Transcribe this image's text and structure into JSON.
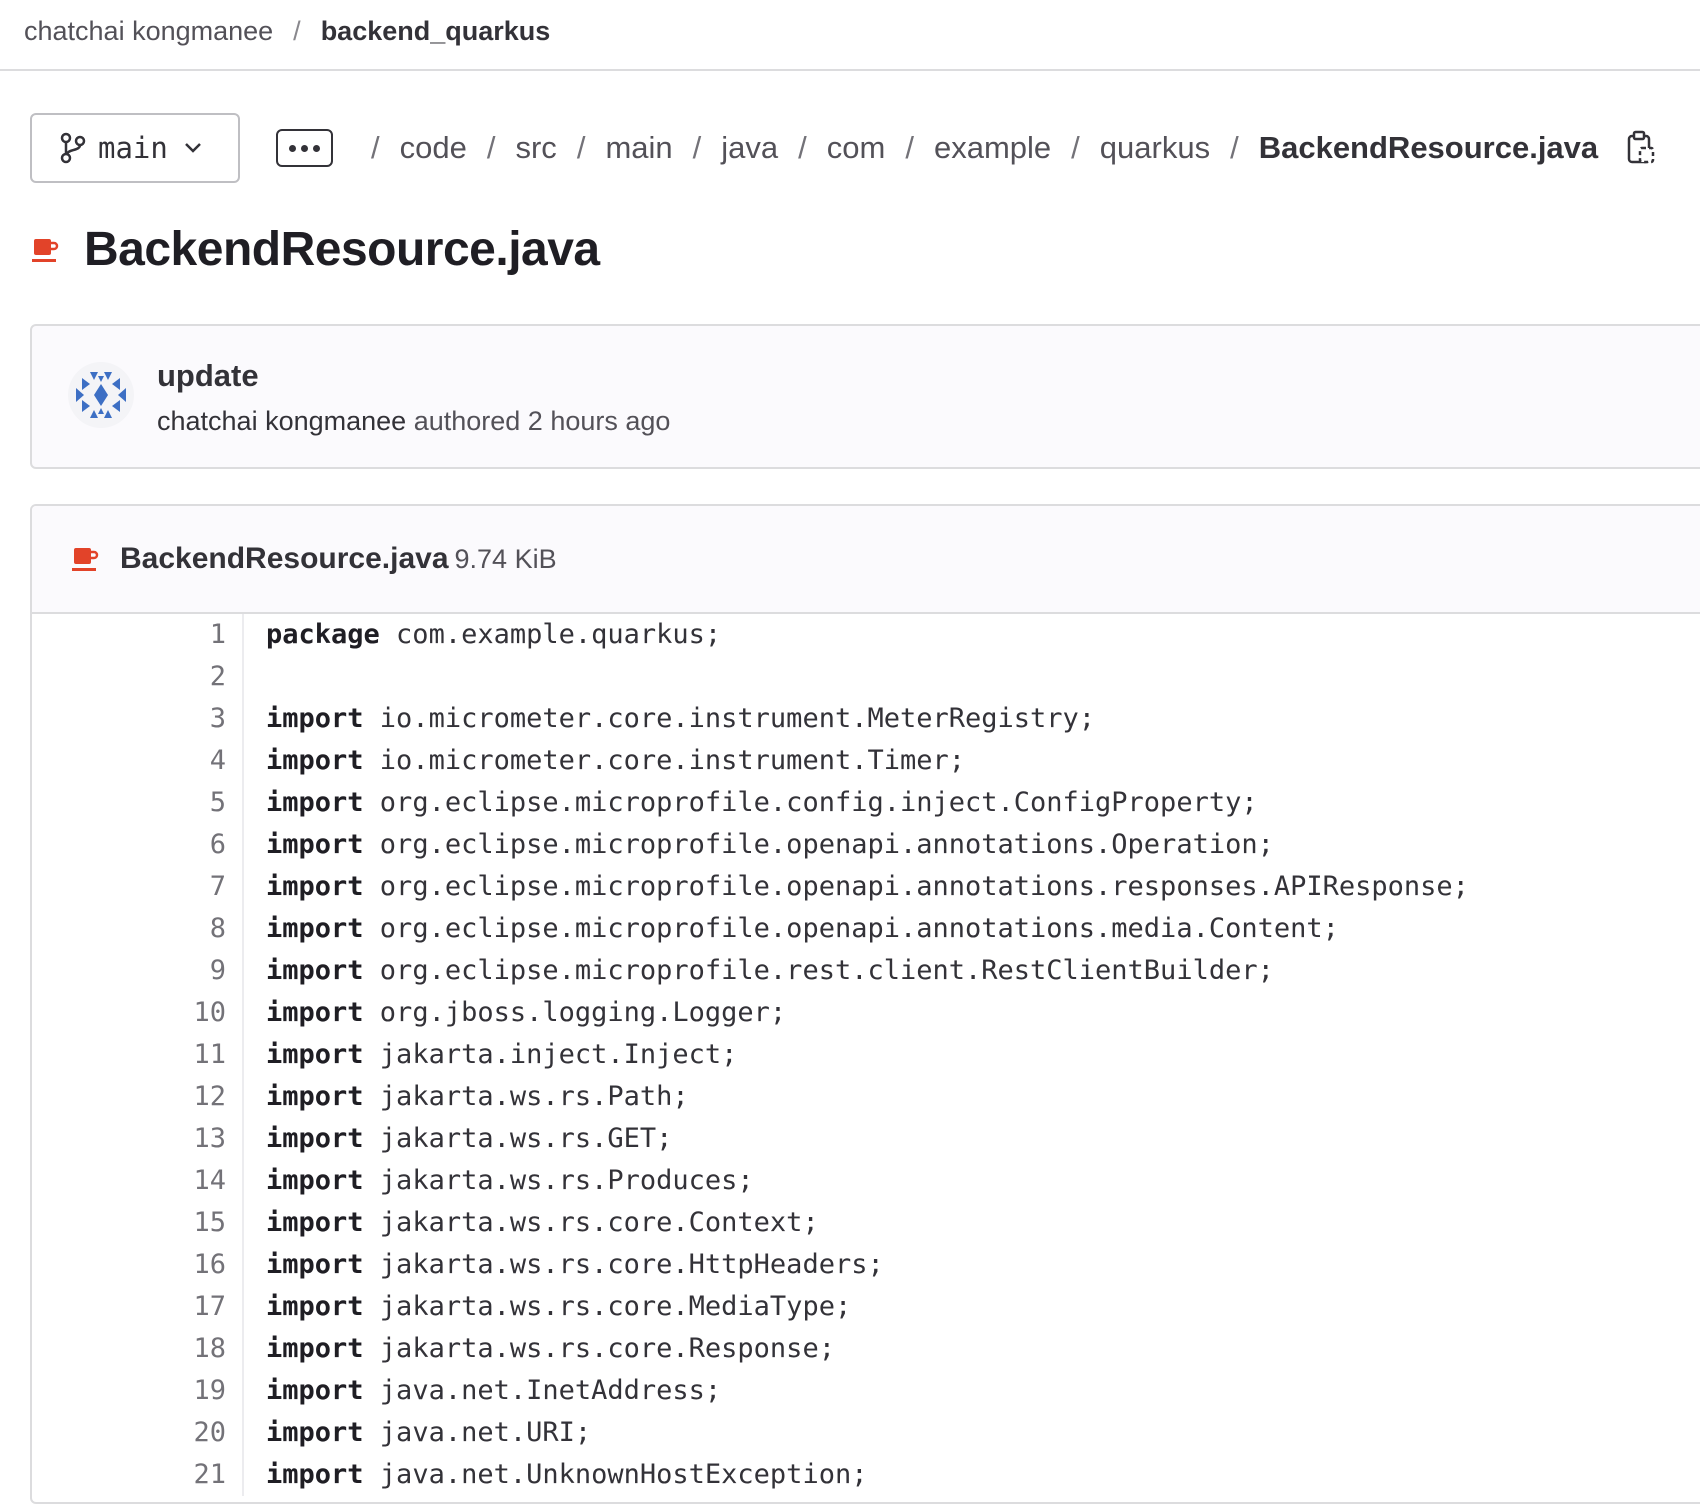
{
  "header": {
    "owner": "chatchai kongmanee",
    "separator": "/",
    "repo": "backend_quarkus"
  },
  "pathbar": {
    "branch": "main",
    "segments": [
      "code",
      "src",
      "main",
      "java",
      "com",
      "example",
      "quarkus"
    ],
    "current_file": "BackendResource.java",
    "separator": "/"
  },
  "file_title": "BackendResource.java",
  "commit": {
    "message": "update",
    "author": "chatchai kongmanee",
    "action": "authored",
    "time": "2 hours ago"
  },
  "file": {
    "name": "BackendResource.java",
    "size": "9.74 KiB"
  },
  "code_lines": [
    {
      "n": "1",
      "kw": "package",
      "rest": " com.example.quarkus;"
    },
    {
      "n": "2",
      "kw": "",
      "rest": ""
    },
    {
      "n": "3",
      "kw": "import",
      "rest": " io.micrometer.core.instrument.MeterRegistry;"
    },
    {
      "n": "4",
      "kw": "import",
      "rest": " io.micrometer.core.instrument.Timer;"
    },
    {
      "n": "5",
      "kw": "import",
      "rest": " org.eclipse.microprofile.config.inject.ConfigProperty;"
    },
    {
      "n": "6",
      "kw": "import",
      "rest": " org.eclipse.microprofile.openapi.annotations.Operation;"
    },
    {
      "n": "7",
      "kw": "import",
      "rest": " org.eclipse.microprofile.openapi.annotations.responses.APIResponse;"
    },
    {
      "n": "8",
      "kw": "import",
      "rest": " org.eclipse.microprofile.openapi.annotations.media.Content;"
    },
    {
      "n": "9",
      "kw": "import",
      "rest": " org.eclipse.microprofile.rest.client.RestClientBuilder;"
    },
    {
      "n": "10",
      "kw": "import",
      "rest": " org.jboss.logging.Logger;"
    },
    {
      "n": "11",
      "kw": "import",
      "rest": " jakarta.inject.Inject;"
    },
    {
      "n": "12",
      "kw": "import",
      "rest": " jakarta.ws.rs.Path;"
    },
    {
      "n": "13",
      "kw": "import",
      "rest": " jakarta.ws.rs.GET;"
    },
    {
      "n": "14",
      "kw": "import",
      "rest": " jakarta.ws.rs.Produces;"
    },
    {
      "n": "15",
      "kw": "import",
      "rest": " jakarta.ws.rs.core.Context;"
    },
    {
      "n": "16",
      "kw": "import",
      "rest": " jakarta.ws.rs.core.HttpHeaders;"
    },
    {
      "n": "17",
      "kw": "import",
      "rest": " jakarta.ws.rs.core.MediaType;"
    },
    {
      "n": "18",
      "kw": "import",
      "rest": " jakarta.ws.rs.core.Response;"
    },
    {
      "n": "19",
      "kw": "import",
      "rest": " java.net.InetAddress;"
    },
    {
      "n": "20",
      "kw": "import",
      "rest": " java.net.URI;"
    },
    {
      "n": "21",
      "kw": "import",
      "rest": " java.net.UnknownHostException;"
    }
  ],
  "icons": {
    "branch": "git-branch-icon",
    "chevron": "chevron-down-icon",
    "copy": "copy-to-clipboard-icon",
    "java": "java-file-icon",
    "avatar": "identicon-avatar"
  },
  "colors": {
    "java_icon": "#e24329",
    "border": "#dcdcde",
    "avatar": "#3d6fc4"
  }
}
